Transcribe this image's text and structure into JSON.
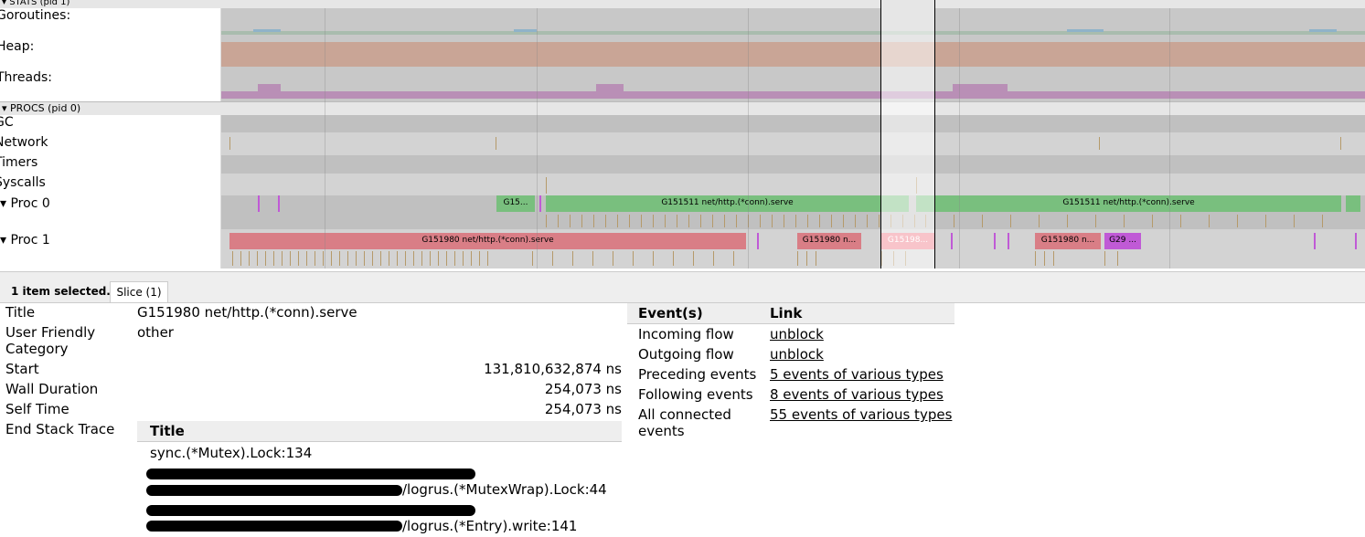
{
  "timeline": {
    "stats_header": "▾ STATS (pid 1)",
    "procs_header": "▾ PROCS (pid 0)",
    "stat_rows": [
      "Goroutines:",
      "Heap:",
      "Threads:"
    ],
    "proc_rows": [
      "GC",
      "Network",
      "Timers",
      "Syscalls"
    ],
    "proc_tracks": [
      "▾  Proc 0",
      "▾  Proc 1"
    ],
    "proc0_slices": [
      "G15...",
      "G151511 net/http.(*conn).serve",
      "G151511 net/http.(*conn).serve"
    ],
    "proc1_slices": [
      "G151980 net/http.(*conn).serve",
      "G151980 n...",
      "G15198...",
      "G151980 n...",
      "G29 ..."
    ],
    "colors": {
      "green": "#79bf7e",
      "red": "#d97e86",
      "heap": "#c9a596",
      "threads": "#b98fb6",
      "purple": "#c05ad6"
    }
  },
  "details": {
    "selection_count": "1 item selected.",
    "tab_label": "Slice (1)",
    "fields": [
      {
        "label": "Title",
        "value": "G151980 net/http.(*conn).serve"
      },
      {
        "label": "User Friendly Category",
        "value": "other"
      },
      {
        "label": "Start",
        "value": "131,810,632,874 ns"
      },
      {
        "label": "Wall Duration",
        "value": "254,073 ns"
      },
      {
        "label": "Self Time",
        "value": "254,073 ns"
      },
      {
        "label": "End Stack Trace",
        "value": ""
      }
    ],
    "stack_header": "Title",
    "stack": [
      "sync.(*Mutex).Lock:134",
      "/logrus.(*MutexWrap).Lock:44",
      "/logrus.(*Entry).write:141"
    ],
    "events_header": "Event(s)",
    "link_header": "Link",
    "events": [
      {
        "event": "Incoming flow",
        "link": "unblock"
      },
      {
        "event": "Outgoing flow",
        "link": "unblock"
      },
      {
        "event": "Preceding events",
        "link": "5 events of various types"
      },
      {
        "event": "Following events",
        "link": "8 events of various types"
      },
      {
        "event": "All connected events",
        "link": "55 events of various types"
      }
    ]
  }
}
